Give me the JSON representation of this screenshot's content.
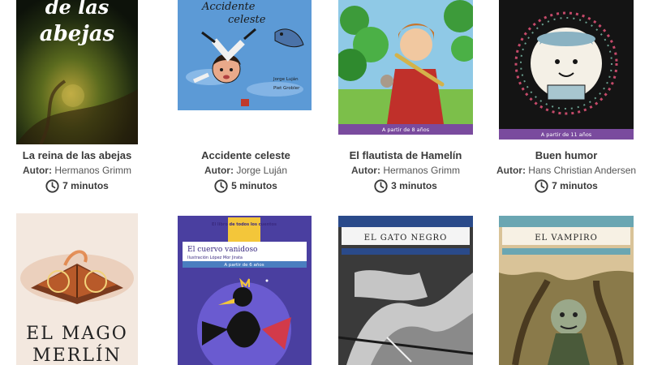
{
  "author_label": "Autor:",
  "books": [
    {
      "title": "La reina de las abejas",
      "author": "Hermanos Grimm",
      "time": "7 minutos",
      "cover_text": "de las\nabejas"
    },
    {
      "title": "Accidente celeste",
      "author": "Jorge Luján",
      "time": "5 minutos",
      "cover_text": "Accidente celeste",
      "cover_author": "Jorge Luján",
      "cover_illustrator": "Piet Grobler"
    },
    {
      "title": "El flautista de Hamelín",
      "author": "Hermanos Grimm",
      "time": "3 minutos",
      "cover_band": "A partir de 8 años"
    },
    {
      "title": "Buen humor",
      "author": "Hans Christian Andersen",
      "time": "7 minutos",
      "cover_band": "A partir de 11 años"
    }
  ],
  "row2_covers": [
    {
      "cover_text": "EL MAGO\nMERLÍN"
    },
    {
      "cover_series": "El libro de todos los cuentos",
      "cover_text": "El cuervo vanidoso",
      "cover_credit": "Ilustración López Mor Jirata",
      "cover_band": "A partir de 6 años"
    },
    {
      "cover_text": "EL GATO NEGRO"
    },
    {
      "cover_text": "EL VAMPIRO"
    }
  ]
}
